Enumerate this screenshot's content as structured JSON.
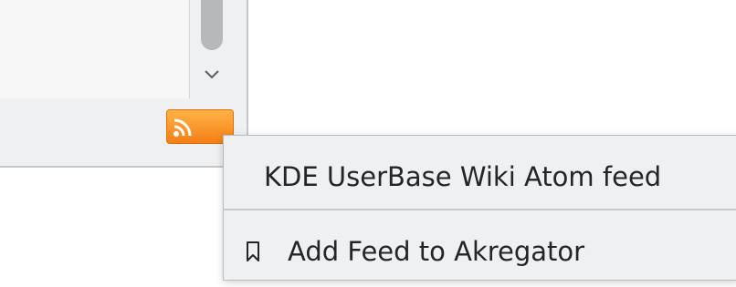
{
  "colors": {
    "rss_orange": "#f57f17",
    "menu_background": "#eff0f1",
    "text": "#232627"
  },
  "scrollbar": {
    "down_icon": "chevron-down-icon"
  },
  "rss_button": {
    "icon": "rss-feed-icon"
  },
  "context_menu": {
    "items": [
      {
        "label": "KDE UserBase Wiki Atom feed",
        "icon": ""
      },
      {
        "label": "Add Feed to Akregator",
        "icon": "bookmark-icon"
      }
    ]
  }
}
